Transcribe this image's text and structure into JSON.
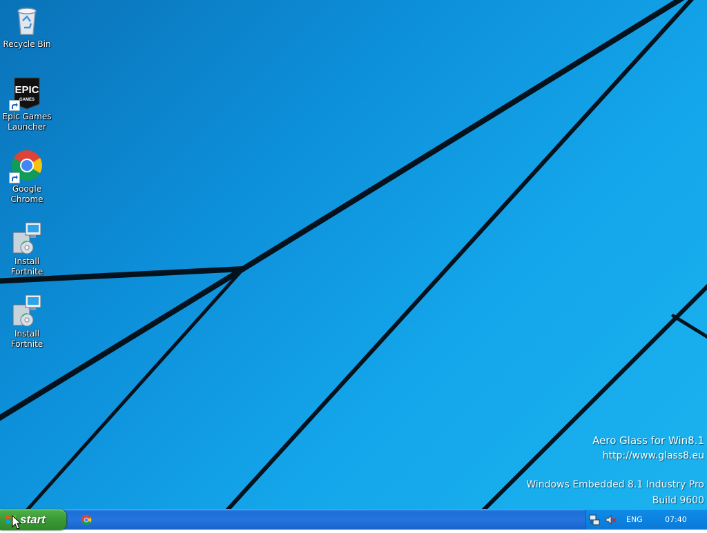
{
  "desktop": {
    "icons": [
      {
        "label": "Recycle Bin",
        "icon": "recycle-bin-icon"
      },
      {
        "label": "Epic Games Launcher",
        "icon": "epic-games-icon",
        "logo_top": "EPIC",
        "logo_bottom": "GAMES"
      },
      {
        "label": "Google Chrome",
        "icon": "chrome-icon"
      },
      {
        "label": "Install Fortnite",
        "icon": "installer-icon"
      },
      {
        "label": "Install Fortnite",
        "icon": "installer-icon"
      }
    ],
    "watermark": {
      "line1": "Aero Glass for Win8.1",
      "line2": "http://www.glass8.eu",
      "line3": "Windows Embedded 8.1 Industry Pro",
      "line4": "Build 9600"
    }
  },
  "taskbar": {
    "start_label": "start",
    "pinned": [
      {
        "icon": "chrome-icon"
      }
    ],
    "tray": {
      "language": "ENG",
      "clock": "07:40",
      "icons": [
        "network-icon",
        "volume-muted-icon"
      ]
    }
  },
  "colors": {
    "desktop_blue": "#14a6ea",
    "taskbar_blue": "#2476de",
    "start_green": "#3c9b36"
  }
}
